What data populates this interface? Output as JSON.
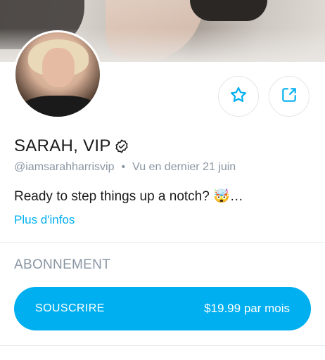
{
  "profile": {
    "name": "SARAH, VIP",
    "handle": "@iamsarahharrisvip",
    "separator": "•",
    "last_seen": "Vu en dernier 21 juin",
    "bio": "Ready to step things up a notch? 🤯…",
    "more_link": "Plus d'infos"
  },
  "subscription": {
    "section_title": "ABONNEMENT",
    "button_label": "SOUSCRIRE",
    "price": "$19.99 par mois"
  },
  "icons": {
    "favorite": "star-icon",
    "share": "share-icon",
    "verified": "verified-badge-icon"
  },
  "colors": {
    "accent": "#00aff0",
    "muted_text": "#8a96a3",
    "primary_text": "#1a1a1a"
  }
}
